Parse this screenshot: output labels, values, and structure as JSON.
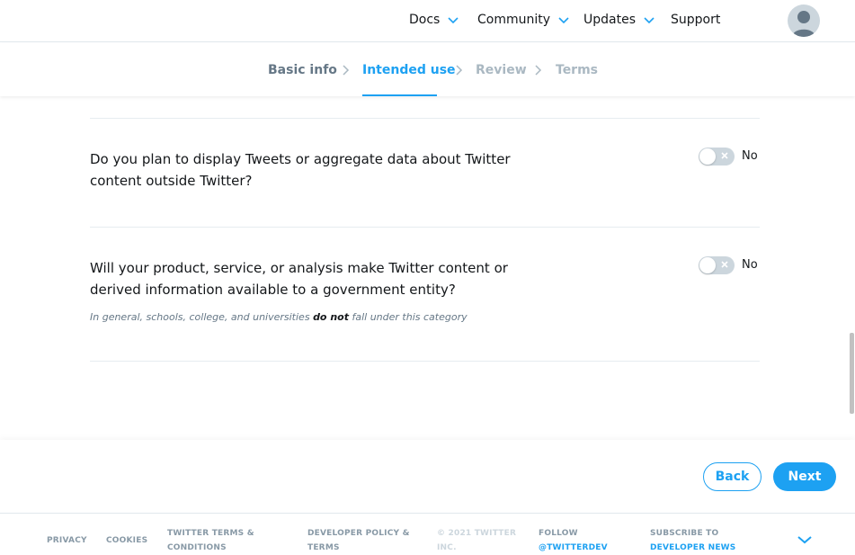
{
  "topnav": {
    "items": [
      {
        "label": "Docs"
      },
      {
        "label": "Community"
      },
      {
        "label": "Updates"
      },
      {
        "label": "Support"
      }
    ]
  },
  "stepper": {
    "steps": [
      {
        "label": "Basic info",
        "state": "done"
      },
      {
        "label": "Intended use",
        "state": "active"
      },
      {
        "label": "Review",
        "state": "todo"
      },
      {
        "label": "Terms",
        "state": "todo"
      }
    ]
  },
  "questions": [
    {
      "text": "Do you plan to display Tweets or aggregate data about Twitter content outside Twitter?",
      "toggle_label": "No"
    },
    {
      "text": "Will your product, service, or analysis make Twitter content or derived information available to a government entity?",
      "toggle_label": "No",
      "hint_before": "In general, schools, college, and universities ",
      "hint_bold": "do not",
      "hint_after": " fall under this category"
    }
  ],
  "actions": {
    "back_label": "Back",
    "next_label": "Next"
  },
  "footer": {
    "privacy": "PRIVACY",
    "cookies": "COOKIES",
    "terms": "TWITTER TERMS & CONDITIONS",
    "dev_policy": "DEVELOPER POLICY & TERMS",
    "copyright": "© 2021 TWITTER INC.",
    "follow_prefix": "FOLLOW",
    "follow_handle": "@TWITTERDEV",
    "subscribe_prefix": "SUBSCRIBE TO",
    "subscribe_link": "DEVELOPER NEWS"
  },
  "colors": {
    "accent": "#1da1f2",
    "text": "#14171a",
    "muted": "#657786"
  }
}
